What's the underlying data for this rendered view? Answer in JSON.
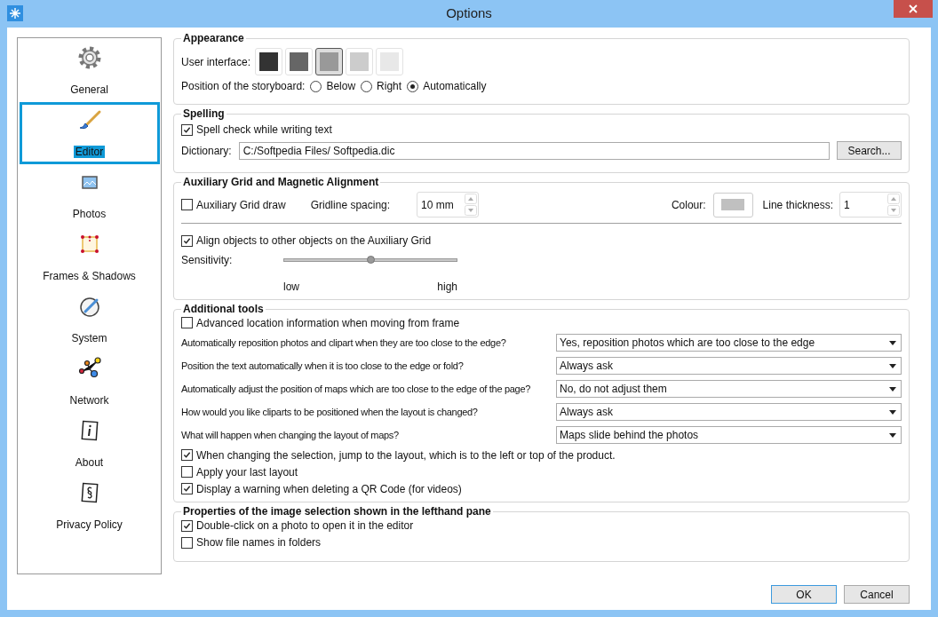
{
  "window": {
    "title": "Options"
  },
  "sidebar": {
    "items": [
      {
        "label": "General",
        "selected": false
      },
      {
        "label": "Editor",
        "selected": true
      },
      {
        "label": "Photos",
        "selected": false
      },
      {
        "label": "Frames & Shadows",
        "selected": false
      },
      {
        "label": "System",
        "selected": false
      },
      {
        "label": "Network",
        "selected": false
      },
      {
        "label": "About",
        "selected": false
      },
      {
        "label": "Privacy Policy",
        "selected": false
      }
    ]
  },
  "appearance": {
    "title": "Appearance",
    "ui_label": "User interface:",
    "swatches": [
      {
        "color": "#333333",
        "selected": false
      },
      {
        "color": "#666666",
        "selected": false
      },
      {
        "color": "#999999",
        "selected": true
      },
      {
        "color": "#cccccc",
        "selected": false
      },
      {
        "color": "#e8e8e8",
        "selected": false
      }
    ],
    "storyboard_label": "Position of the storyboard:",
    "storyboard_options": [
      {
        "label": "Below",
        "selected": false
      },
      {
        "label": "Right",
        "selected": false
      },
      {
        "label": "Automatically",
        "selected": true
      }
    ]
  },
  "spelling": {
    "title": "Spelling",
    "spell_check": {
      "label": "Spell check while writing text",
      "checked": true
    },
    "dictionary_label": "Dictionary:",
    "dictionary_value": "C:/Softpedia Files/ Softpedia.dic",
    "search_button": "Search..."
  },
  "grid": {
    "title": "Auxiliary Grid and Magnetic Alignment",
    "grid_draw": {
      "label": "Auxiliary Grid draw",
      "checked": false
    },
    "spacing_label": "Gridline spacing:",
    "spacing_value": "10 mm",
    "colour_label": "Colour:",
    "thickness_label": "Line thickness:",
    "thickness_value": "1",
    "align": {
      "label": "Align objects to other objects on the Auxiliary Grid",
      "checked": true
    },
    "sensitivity_label": "Sensitivity:",
    "sensitivity": {
      "level": 0.5
    },
    "low_label": "low",
    "high_label": "high"
  },
  "additional": {
    "title": "Additional tools",
    "items": [
      {
        "kind": "checkbox",
        "label": "Advanced location information when moving from frame",
        "checked": false
      },
      {
        "kind": "select",
        "label": "Automatically reposition photos and clipart when they are too close to the edge?",
        "value": "Yes, reposition photos which are too close to the edge"
      },
      {
        "kind": "select",
        "label": "Position the text automatically when it is too close to the edge or fold?",
        "value": "Always ask"
      },
      {
        "kind": "select",
        "label": "Automatically adjust the position of maps which are too close to the edge of the page?",
        "value": "No, do not adjust them"
      },
      {
        "kind": "select",
        "label": "How would you like cliparts to be positioned when the layout is changed?",
        "value": "Always ask"
      },
      {
        "kind": "select",
        "label": "What will happen when changing the layout of maps?",
        "value": "Maps slide behind the photos"
      },
      {
        "kind": "checkbox",
        "label": "When changing the selection, jump to the layout, which is to the left or top of the product.",
        "checked": true
      },
      {
        "kind": "checkbox",
        "label": "Apply your last layout",
        "checked": false
      },
      {
        "kind": "checkbox",
        "label": "Display a warning when deleting a QR Code (for videos)",
        "checked": true
      }
    ]
  },
  "selection": {
    "title": "Properties of the image selection shown in the lefthand pane",
    "items": [
      {
        "label": "Double-click on a photo to open it in the editor",
        "checked": true
      },
      {
        "label": "Show file names in folders",
        "checked": false
      }
    ]
  },
  "buttons": [
    "OK",
    "Cancel"
  ]
}
